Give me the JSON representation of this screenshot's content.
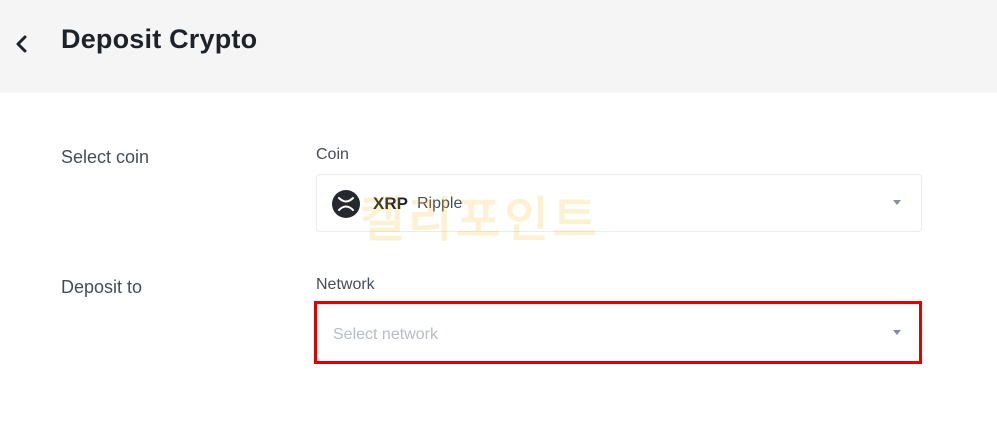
{
  "header": {
    "title": "Deposit Crypto",
    "back_icon": "chevron-left-icon"
  },
  "coin_row": {
    "label": "Select coin",
    "field_label": "Coin",
    "selected": {
      "symbol": "XRP",
      "name": "Ripple",
      "icon": "xrp-icon"
    }
  },
  "deposit_row": {
    "label": "Deposit to",
    "field_label": "Network",
    "placeholder": "Select network"
  },
  "colors": {
    "highlight": "#e00000",
    "header_bg": "#f5f5f5",
    "watermark": "#f0b90b"
  },
  "watermark_text": "켈리포인트"
}
